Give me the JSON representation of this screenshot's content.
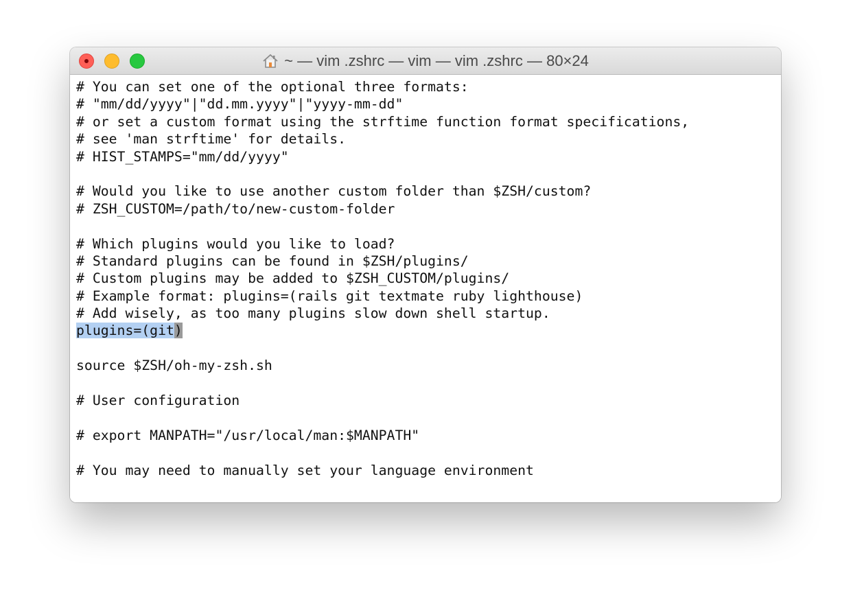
{
  "window": {
    "title": "~ — vim .zshrc — vim — vim .zshrc — 80×24",
    "title_icon": "home-icon",
    "buttons": [
      "close",
      "minimize",
      "zoom"
    ]
  },
  "colors": {
    "close": "#fe5f57",
    "minimize": "#febc2e",
    "zoom": "#28c840",
    "selection": "#b3d0f2",
    "cursor": "#9a9a9a"
  },
  "editor": {
    "lines": [
      "# You can set one of the optional three formats:",
      "# \"mm/dd/yyyy\"|\"dd.mm.yyyy\"|\"yyyy-mm-dd\"",
      "# or set a custom format using the strftime function format specifications,",
      "# see 'man strftime' for details.",
      "# HIST_STAMPS=\"mm/dd/yyyy\"",
      "",
      "# Would you like to use another custom folder than $ZSH/custom?",
      "# ZSH_CUSTOM=/path/to/new-custom-folder",
      "",
      "# Which plugins would you like to load?",
      "# Standard plugins can be found in $ZSH/plugins/",
      "# Custom plugins may be added to $ZSH_CUSTOM/plugins/",
      "# Example format: plugins=(rails git textmate ruby lighthouse)",
      "# Add wisely, as too many plugins slow down shell startup.",
      "",
      "",
      "source $ZSH/oh-my-zsh.sh",
      "",
      "# User configuration",
      "",
      "# export MANPATH=\"/usr/local/man:$MANPATH\"",
      "",
      "# You may need to manually set your language environment"
    ],
    "selected_line": {
      "selected_text": "plugins=(git",
      "cursor_char": ")"
    }
  }
}
